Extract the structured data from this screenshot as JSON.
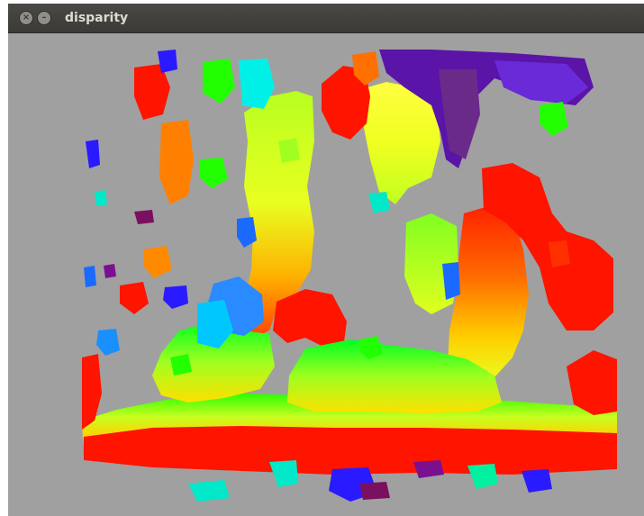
{
  "window": {
    "title": "disparity",
    "close_glyph": "×",
    "minimize_glyph": "–"
  },
  "icons": {
    "close": "close-icon",
    "minimize": "minimize-icon"
  },
  "colors": {
    "background_gray": "#a0a0a0",
    "near_red": "#ff1400",
    "orange": "#ff7a00",
    "yellow": "#f0ff20",
    "yellow_green": "#c8ff20",
    "green": "#2aff00",
    "cyan": "#00f0e8",
    "blue": "#1a6aff",
    "deep_blue": "#2a1aff",
    "purple": "#6a10a0"
  }
}
